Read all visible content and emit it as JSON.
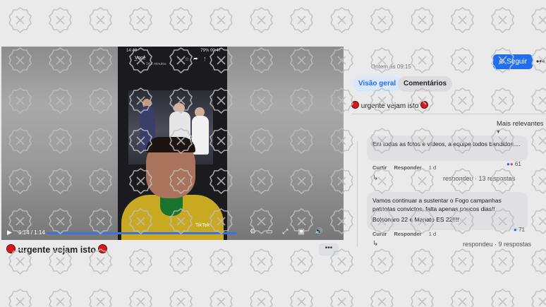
{
  "video": {
    "phone_status_left": "14:48",
    "phone_status_right": "79% 00:47",
    "phone_title": "Você",
    "phone_subtitle": "14,7 minutos",
    "watermark": "TikTok",
    "time": "1:14 / 1:14",
    "progress": 1.0
  },
  "title": "urgente vejam isto",
  "right": {
    "posted": "Ontem às 09:15 ·",
    "follow_label": "Seguir",
    "tabs": [
      "Visão geral",
      "Comentários"
    ],
    "caption": "urgente vejam isto",
    "sort_label": "Mais relevantes",
    "comments": [
      {
        "text": "Em todas as fotos e vídeos, a equipe todos bandidos....",
        "like": "Curtir",
        "reply": "Responder",
        "age": "1 d",
        "reactions": "61",
        "replies": "respondeu · 13 respostas"
      },
      {
        "text": "Vamos continuar a sustentar o Fogo campanhas patriotas convictos, falta apenas poucos dias!!",
        "text2": "Bolsonaro 22 e Manato ES 22!!!!",
        "like": "Curtir",
        "reply": "Responder",
        "age": "1 d",
        "reactions": "71",
        "replies": "respondeu · 9 respostas"
      }
    ]
  },
  "colors": {
    "accent": "#1f6ff0",
    "red_dot": "#d5191c"
  }
}
